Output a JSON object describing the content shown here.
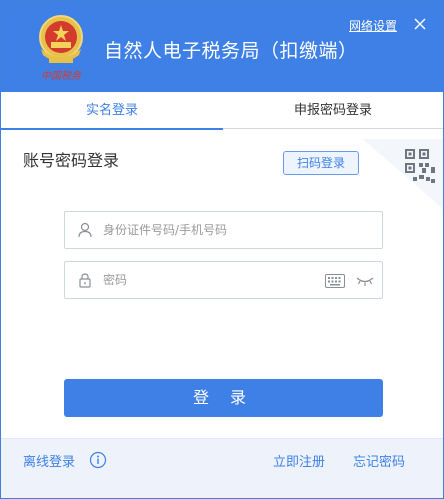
{
  "header": {
    "title": "自然人电子税务局（扣缴端）",
    "network_settings": "网络设置",
    "emblem_icon": "tax-emblem-icon",
    "close_icon": "close-icon",
    "bg_color": "#3f80e6"
  },
  "tabs": [
    {
      "label": "实名登录",
      "active": true
    },
    {
      "label": "申报密码登录",
      "active": false
    }
  ],
  "login": {
    "heading": "账号密码登录",
    "scan_button": "扫码登录",
    "qr_icon": "qr-code-icon",
    "username": {
      "placeholder": "身份证件号码/手机号码",
      "value": ""
    },
    "password": {
      "placeholder": "密码",
      "value": ""
    },
    "submit": "登 录"
  },
  "footer": {
    "offline_login": "离线登录",
    "register": "立即注册",
    "forgot_password": "忘记密码"
  }
}
